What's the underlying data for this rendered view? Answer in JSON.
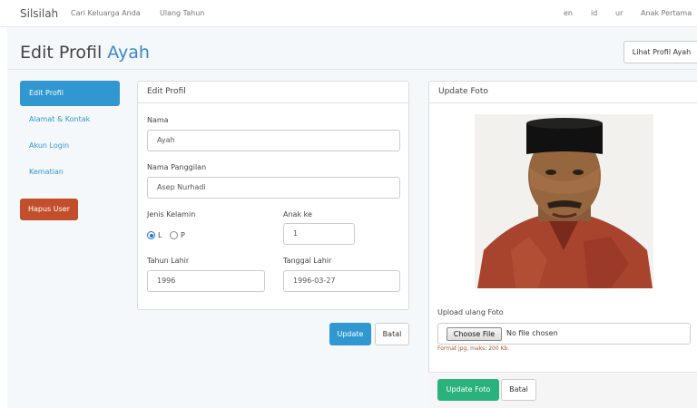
{
  "nav": {
    "brand": "Silsilah",
    "links": [
      "Cari Keluarga Anda",
      "Ulang Tahun"
    ],
    "langs": [
      "en",
      "id",
      "ur"
    ],
    "user": "Anak Pertama"
  },
  "header": {
    "title_prefix": "Edit Profil ",
    "title_name": "Ayah",
    "view_profile_label": "Lihat Profil Ayah"
  },
  "sidebar": {
    "active": "Edit Profil",
    "items": [
      "Alamat & Kontak",
      "Akun Login",
      "Kematian"
    ],
    "delete_label": "Hapus User"
  },
  "edit_panel": {
    "heading": "Edit Profil",
    "name_label": "Nama",
    "name_value": "Ayah",
    "nickname_label": "Nama Panggilan",
    "nickname_value": "Asep Nurhadi",
    "gender_label": "Jenis Kelamin",
    "gender_options": [
      "L",
      "P"
    ],
    "gender_selected": "L",
    "child_order_label": "Anak ke",
    "child_order_value": "1",
    "birth_year_label": "Tahun Lahir",
    "birth_year_value": "1996",
    "birth_date_label": "Tanggal Lahir",
    "birth_date_value": "1996-03-27",
    "update_label": "Update",
    "cancel_label": "Batal"
  },
  "photo_panel": {
    "heading": "Update Foto",
    "upload_label": "Upload ulang Foto",
    "choose_file_label": "Choose File",
    "no_file_text": "No file chosen",
    "hint": "Format jpg, maks: 200 Kb.",
    "update_label": "Update Foto",
    "cancel_label": "Batal"
  },
  "colors": {
    "primary": "#3097d1",
    "danger": "#c24e2b",
    "success": "#2ab27b"
  }
}
